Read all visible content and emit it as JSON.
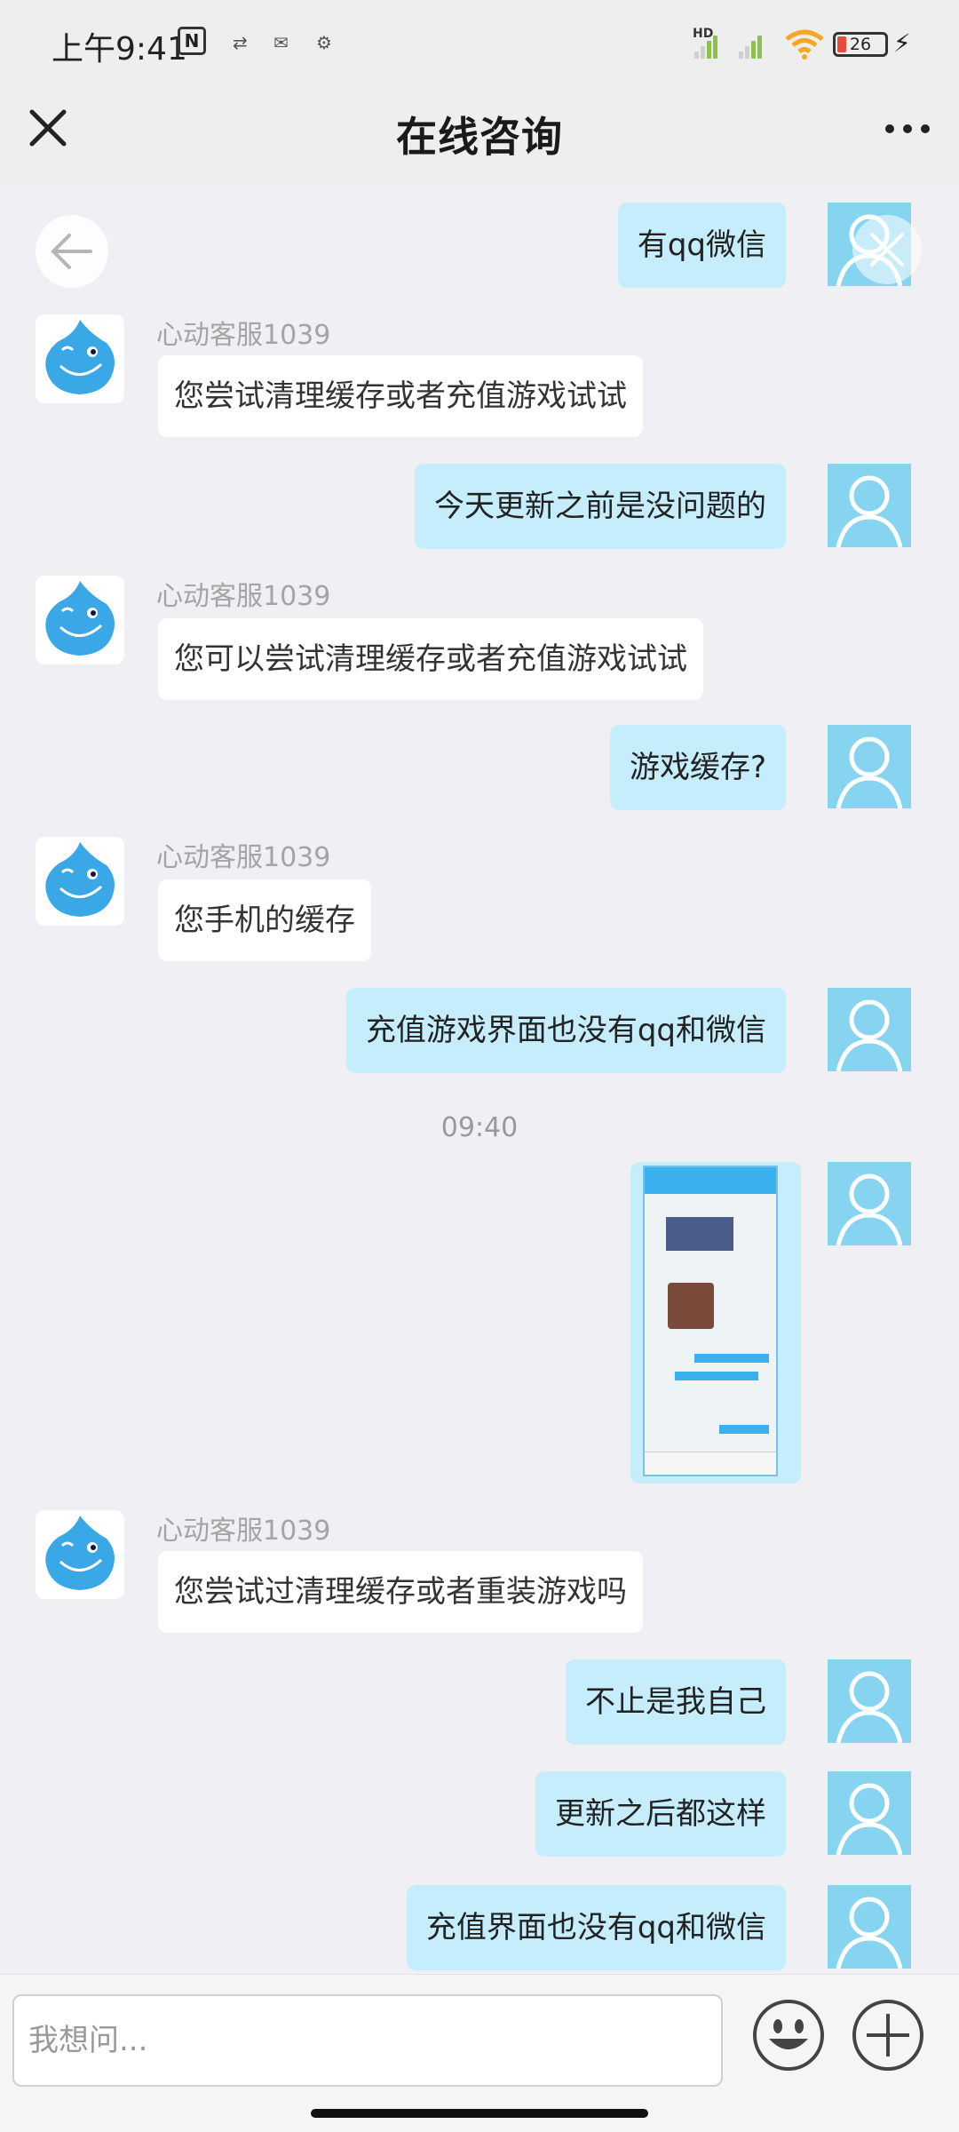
{
  "status_bar": {
    "time": "上午9:41",
    "nfc": "N",
    "network_type": "HD",
    "battery": "26"
  },
  "header": {
    "title": "在线咨询"
  },
  "chat": {
    "agent_name": "心动客服1039",
    "messages": [
      {
        "from": "user",
        "text": "有qq微信"
      },
      {
        "from": "agent",
        "name": "心动客服1039",
        "text": "您尝试清理缓存或者充值游戏试试"
      },
      {
        "from": "user",
        "text": "今天更新之前是没问题的"
      },
      {
        "from": "agent",
        "name": "心动客服1039",
        "text": "您可以尝试清理缓存或者充值游戏试试"
      },
      {
        "from": "user",
        "text": "游戏缓存?"
      },
      {
        "from": "agent",
        "name": "心动客服1039",
        "text": "您手机的缓存"
      },
      {
        "from": "user",
        "text": "充值游戏界面也没有qq和微信"
      },
      {
        "from": "timestamp",
        "text": "09:40"
      },
      {
        "from": "user",
        "type": "image"
      },
      {
        "from": "agent",
        "name": "心动客服1039",
        "text": "您尝试过清理缓存或者重装游戏吗"
      },
      {
        "from": "user",
        "text": "不止是我自己"
      },
      {
        "from": "user",
        "text": "更新之后都这样"
      },
      {
        "from": "user",
        "text": "充值界面也没有qq和微信"
      }
    ]
  },
  "input": {
    "placeholder": "我想问..."
  },
  "icons": {
    "close": "close-icon",
    "more": "more-icon",
    "back": "arrow-left-icon",
    "emoji": "emoji-icon",
    "plus": "plus-icon"
  },
  "colors": {
    "user_bubble": "#c6edfb",
    "agent_bubble": "#ffffff",
    "user_avatar": "#87d4f1"
  }
}
